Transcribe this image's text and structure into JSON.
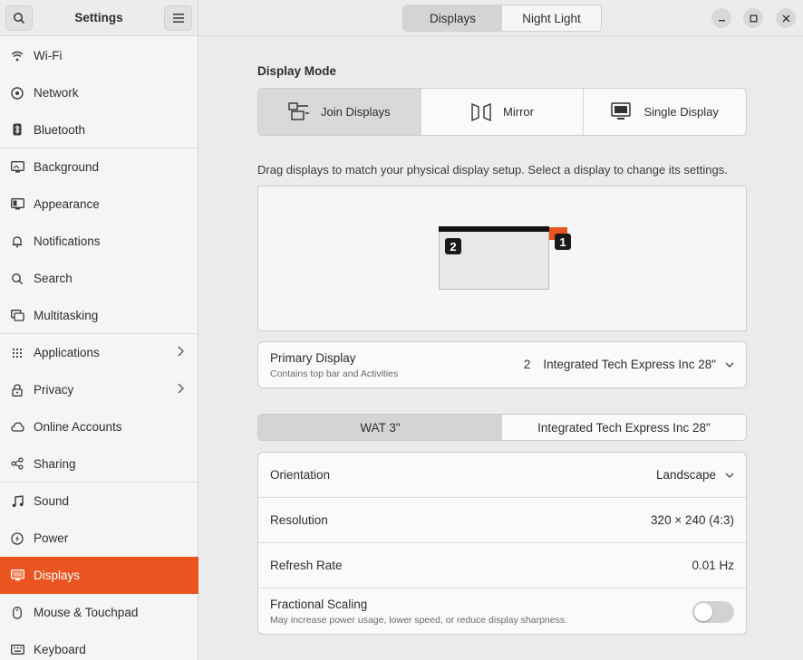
{
  "sidebar": {
    "title": "Settings",
    "search_icon": "search-icon",
    "menu_icon": "hamburger-menu-icon",
    "items": [
      {
        "label": "Wi-Fi",
        "icon": "wifi-icon"
      },
      {
        "label": "Network",
        "icon": "network-icon"
      },
      {
        "label": "Bluetooth",
        "icon": "bluetooth-icon"
      },
      {
        "label": "Background",
        "icon": "background-icon"
      },
      {
        "label": "Appearance",
        "icon": "appearance-icon"
      },
      {
        "label": "Notifications",
        "icon": "bell-icon"
      },
      {
        "label": "Search",
        "icon": "search-icon"
      },
      {
        "label": "Multitasking",
        "icon": "multitasking-icon"
      },
      {
        "label": "Applications",
        "icon": "grid-icon"
      },
      {
        "label": "Privacy",
        "icon": "lock-icon"
      },
      {
        "label": "Online Accounts",
        "icon": "cloud-icon"
      },
      {
        "label": "Sharing",
        "icon": "share-icon"
      },
      {
        "label": "Sound",
        "icon": "music-note-icon"
      },
      {
        "label": "Power",
        "icon": "power-icon"
      },
      {
        "label": "Displays",
        "icon": "display-icon"
      },
      {
        "label": "Mouse & Touchpad",
        "icon": "mouse-icon"
      },
      {
        "label": "Keyboard",
        "icon": "keyboard-icon"
      }
    ]
  },
  "header": {
    "tabs": [
      "Displays",
      "Night Light"
    ],
    "active_tab": "Displays"
  },
  "display_mode": {
    "label": "Display Mode",
    "options": [
      "Join Displays",
      "Mirror",
      "Single Display"
    ],
    "selected": "Join Displays"
  },
  "hint": "Drag displays to match your physical display setup. Select a display to change its settings.",
  "arrangement": {
    "monitor_1_badge": "1",
    "monitor_2_badge": "2"
  },
  "primary_display": {
    "label": "Primary Display",
    "sublabel": "Contains top bar and Activities",
    "number": "2",
    "value": "Integrated Tech Express Inc 28\""
  },
  "monitor_tabs": [
    "WAT 3\"",
    "Integrated Tech Express Inc 28\""
  ],
  "settings": {
    "orientation_label": "Orientation",
    "orientation_value": "Landscape",
    "resolution_label": "Resolution",
    "resolution_value": "320 × 240 (4:3)",
    "refresh_label": "Refresh Rate",
    "refresh_value": "0.01 Hz",
    "scaling_label": "Fractional Scaling",
    "scaling_sublabel": "May increase power usage, lower speed, or reduce display sharpness."
  },
  "colors": {
    "accent": "#e95420"
  }
}
